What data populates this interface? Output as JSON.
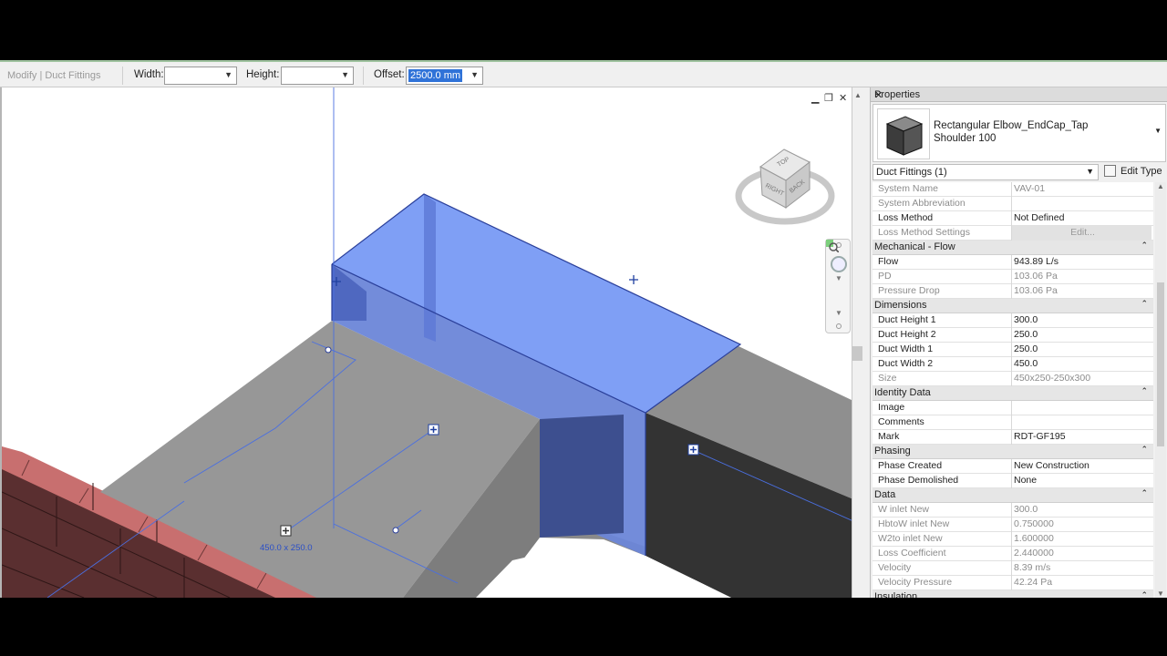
{
  "options_bar": {
    "context": "Modify | Duct Fittings",
    "width_label": "Width:",
    "width_value": "",
    "height_label": "Height:",
    "height_value": "",
    "offset_label": "Offset:",
    "offset_value": "2500.0 mm"
  },
  "viewport": {
    "dimension_label": "450.0 x 250.0",
    "view_cube": {
      "face_top": "TOP",
      "face_left": "RIGHT",
      "face_right": "BACK"
    },
    "window_controls": {
      "minimize": "▁",
      "restore": "❐",
      "close": "✕"
    }
  },
  "properties": {
    "title": "Properties",
    "close": "✕",
    "type_name": "Rectangular Elbow_EndCap_Tap",
    "type_variant": "Shoulder 100",
    "filter": "Duct Fittings (1)",
    "edit_type": "Edit Type",
    "rows": [
      {
        "kind": "prop",
        "name": "System Name",
        "value": "VAV-01",
        "readonly": true
      },
      {
        "kind": "prop",
        "name": "System Abbreviation",
        "value": "",
        "readonly": true
      },
      {
        "kind": "prop",
        "name": "Loss Method",
        "value": "Not Defined",
        "readonly": false
      },
      {
        "kind": "prop",
        "name": "Loss Method Settings",
        "value": "Edit...",
        "readonly": true,
        "button": true
      },
      {
        "kind": "group",
        "name": "Mechanical - Flow"
      },
      {
        "kind": "prop",
        "name": "Flow",
        "value": "943.89 L/s",
        "readonly": false
      },
      {
        "kind": "prop",
        "name": "PD",
        "value": "103.06 Pa",
        "readonly": true
      },
      {
        "kind": "prop",
        "name": "Pressure Drop",
        "value": "103.06 Pa",
        "readonly": true
      },
      {
        "kind": "group",
        "name": "Dimensions"
      },
      {
        "kind": "prop",
        "name": "Duct Height 1",
        "value": "300.0",
        "readonly": false
      },
      {
        "kind": "prop",
        "name": "Duct Height 2",
        "value": "250.0",
        "readonly": false
      },
      {
        "kind": "prop",
        "name": "Duct Width 1",
        "value": "250.0",
        "readonly": false
      },
      {
        "kind": "prop",
        "name": "Duct Width 2",
        "value": "450.0",
        "readonly": false
      },
      {
        "kind": "prop",
        "name": "Size",
        "value": "450x250-250x300",
        "readonly": true
      },
      {
        "kind": "group",
        "name": "Identity Data"
      },
      {
        "kind": "prop",
        "name": "Image",
        "value": "",
        "readonly": false
      },
      {
        "kind": "prop",
        "name": "Comments",
        "value": "",
        "readonly": false
      },
      {
        "kind": "prop",
        "name": "Mark",
        "value": "RDT-GF195",
        "readonly": false
      },
      {
        "kind": "group",
        "name": "Phasing"
      },
      {
        "kind": "prop",
        "name": "Phase Created",
        "value": "New Construction",
        "readonly": false
      },
      {
        "kind": "prop",
        "name": "Phase Demolished",
        "value": "None",
        "readonly": false
      },
      {
        "kind": "group",
        "name": "Data"
      },
      {
        "kind": "prop",
        "name": "W inlet New",
        "value": "300.0",
        "readonly": true
      },
      {
        "kind": "prop",
        "name": "HbtoW inlet New",
        "value": "0.750000",
        "readonly": true
      },
      {
        "kind": "prop",
        "name": "W2to inlet New",
        "value": "1.600000",
        "readonly": true
      },
      {
        "kind": "prop",
        "name": "Loss Coefficient",
        "value": "2.440000",
        "readonly": true
      },
      {
        "kind": "prop",
        "name": "Velocity",
        "value": "8.39 m/s",
        "readonly": true
      },
      {
        "kind": "prop",
        "name": "Velocity Pressure",
        "value": "42.24 Pa",
        "readonly": true
      },
      {
        "kind": "group",
        "name": "Insulation"
      }
    ]
  },
  "colors": {
    "selection_blue": "#6f93f2",
    "duct_gray": "#979797",
    "duct_dark": "#333333",
    "brick": "#c86f6f"
  }
}
